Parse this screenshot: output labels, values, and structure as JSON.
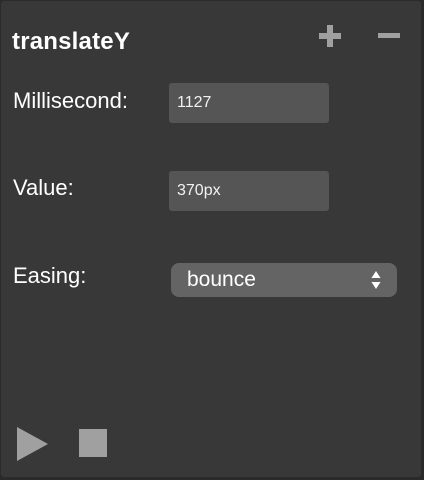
{
  "panel": {
    "title": "translateY",
    "add_icon": "plus-icon",
    "remove_icon": "minus-icon"
  },
  "fields": {
    "millisecond": {
      "label": "Millisecond:",
      "value": "1127"
    },
    "value": {
      "label": "Value:",
      "value": "370px"
    },
    "easing": {
      "label": "Easing:",
      "selected": "bounce"
    }
  },
  "controls": {
    "play_icon": "play-icon",
    "stop_icon": "stop-icon"
  },
  "colors": {
    "background": "#383838",
    "field_bg": "#555555",
    "select_bg": "#646464",
    "icon_gray": "#a0a0a0",
    "text": "#ffffff"
  }
}
